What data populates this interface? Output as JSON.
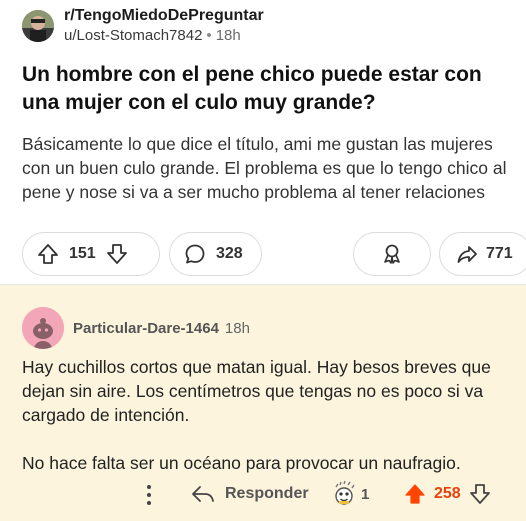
{
  "post": {
    "subreddit": "r/TengoMiedoDePreguntar",
    "author": "u/Lost-Stomach7842",
    "separator": "•",
    "time": "18h",
    "title": "Un hombre con el pene chico puede estar con una mujer con el culo muy grande?",
    "body": "Básicamente lo que dice el título, ami me gustan las mujeres con un buen culo grande. El problema es que lo tengo chico al pene y nose si va a ser mucho problema al tener relaciones",
    "votes": "151",
    "comments": "328",
    "shares": "771"
  },
  "comment": {
    "author": "Particular-Dare-1464",
    "time": "18h",
    "paragraphs": [
      "Hay cuchillos cortos que matan igual. Hay besos breves que dejan sin aire. Los centímetros que tengas no es poco si va cargado de intención.",
      "No hace falta ser un océano para provocar un naufragio."
    ],
    "reply_label": "Responder",
    "award_count": "1",
    "votes": "258"
  },
  "colors": {
    "upvote_active": "#ff4500",
    "comment_bg": "#fcf4dd",
    "avatar_bg": "#f3a6b8"
  },
  "icons": {
    "upvote": "arrow-up-icon",
    "downvote": "arrow-down-icon",
    "comments": "speech-bubble-icon",
    "award": "award-ribbon-icon",
    "share": "share-arrow-icon",
    "more": "vertical-dots-icon",
    "reply": "reply-arrow-icon"
  }
}
